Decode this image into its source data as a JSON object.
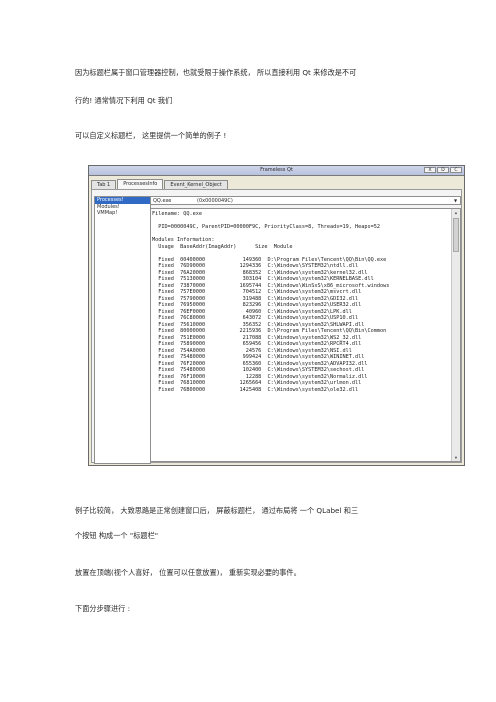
{
  "paragraphs": [
    "因为标题栏属于窗口管理器控制，也就受限于操作系统，  所以直接利用 Qt 来修改是不可",
    "行的!  通常情况下利用 Qt 我们",
    "可以自定义标题栏，   这里提供一个简单的例子 !",
    "例子比较简，  大致思路是正常创建窗口后，  屏蔽标题栏，  通过布局将  一个 QLabel 和三",
    "个按钮  构成一个  \"标题栏\"",
    "放置在顶端(视个人喜好，  位置可以任意放置)，  重新实现必要的事件。",
    "下面分步骤进行 :"
  ],
  "window": {
    "title": "Frameless Qt",
    "buttons": [
      "X",
      "D",
      "C"
    ],
    "tabs": [
      "Tab 1",
      "ProcessesInfo",
      "Event_Kernel_Object"
    ],
    "list_items": [
      "Processes!",
      "Modules!",
      "VMMap!"
    ],
    "combo": {
      "name": "QQ.exe",
      "pid": "(0x0000049C)"
    },
    "text_lines": [
      "Filename: QQ.exe",
      "",
      "  PID=0000049C, ParentPID=00000F9C, PriorityClass=8, Threads=19, Heaps=52",
      "",
      "Modules Information:",
      "  Usage  BaseAddr(ImagAddr)      Size  Module",
      "",
      "  Fixed  00400000            149360  D:\\Program Files\\Tencent\\QQ\\Bin\\QQ.exe",
      "  Fixed  76D90000           1294336  C:\\Windows\\SYSTEM32\\ntdll.dll",
      "  Fixed  76A20000            868352  C:\\Windows\\system32\\kernel32.dll",
      "  Fixed  75130000            303104  C:\\Windows\\system32\\KERNELBASE.dll",
      "  Fixed  73870000           1695744  C:\\Windows\\WinSxS\\x86_microsoft.windows",
      "  Fixed  757E0000            704512  C:\\Windows\\system32\\msvcrt.dll",
      "  Fixed  75790000            319488  C:\\Windows\\system32\\GDI32.dll",
      "  Fixed  76950000            823296  C:\\Windows\\system32\\USER32.dll",
      "  Fixed  76EF0000             40960  C:\\Windows\\system32\\LPK.dll",
      "  Fixed  76C80000            643072  C:\\Windows\\system32\\USP10.dll",
      "  Fixed  75610000            356352  C:\\Windows\\system32\\SHLWAPI.dll",
      "  Fixed  80000000           2215936  D:\\Program Files\\Tencent\\QQ\\Bin\\Common",
      "  Fixed  751E0000            217088  C:\\Windows\\system32\\WS2_32.dll",
      "  Fixed  75890000            659456  C:\\Windows\\system32\\RPCRT4.dll",
      "  Fixed  754A0000             24576  C:\\Windows\\system32\\NSI.dll",
      "  Fixed  75480000            999424  C:\\Windows\\system32\\WININET.dll",
      "  Fixed  76F20000            655360  C:\\Windows\\system32\\ADVAPI32.dll",
      "  Fixed  75480000            102400  C:\\Windows\\SYSTEM32\\sechost.dll",
      "  Fixed  76F10000             12288  C:\\Windows\\system32\\Normaliz.dll",
      "  Fixed  76810000           1265664  C:\\Windows\\system32\\urlmon.dll",
      "  Fixed  76B00000           1425408  C:\\Windows\\system32\\ole32.dll"
    ]
  }
}
